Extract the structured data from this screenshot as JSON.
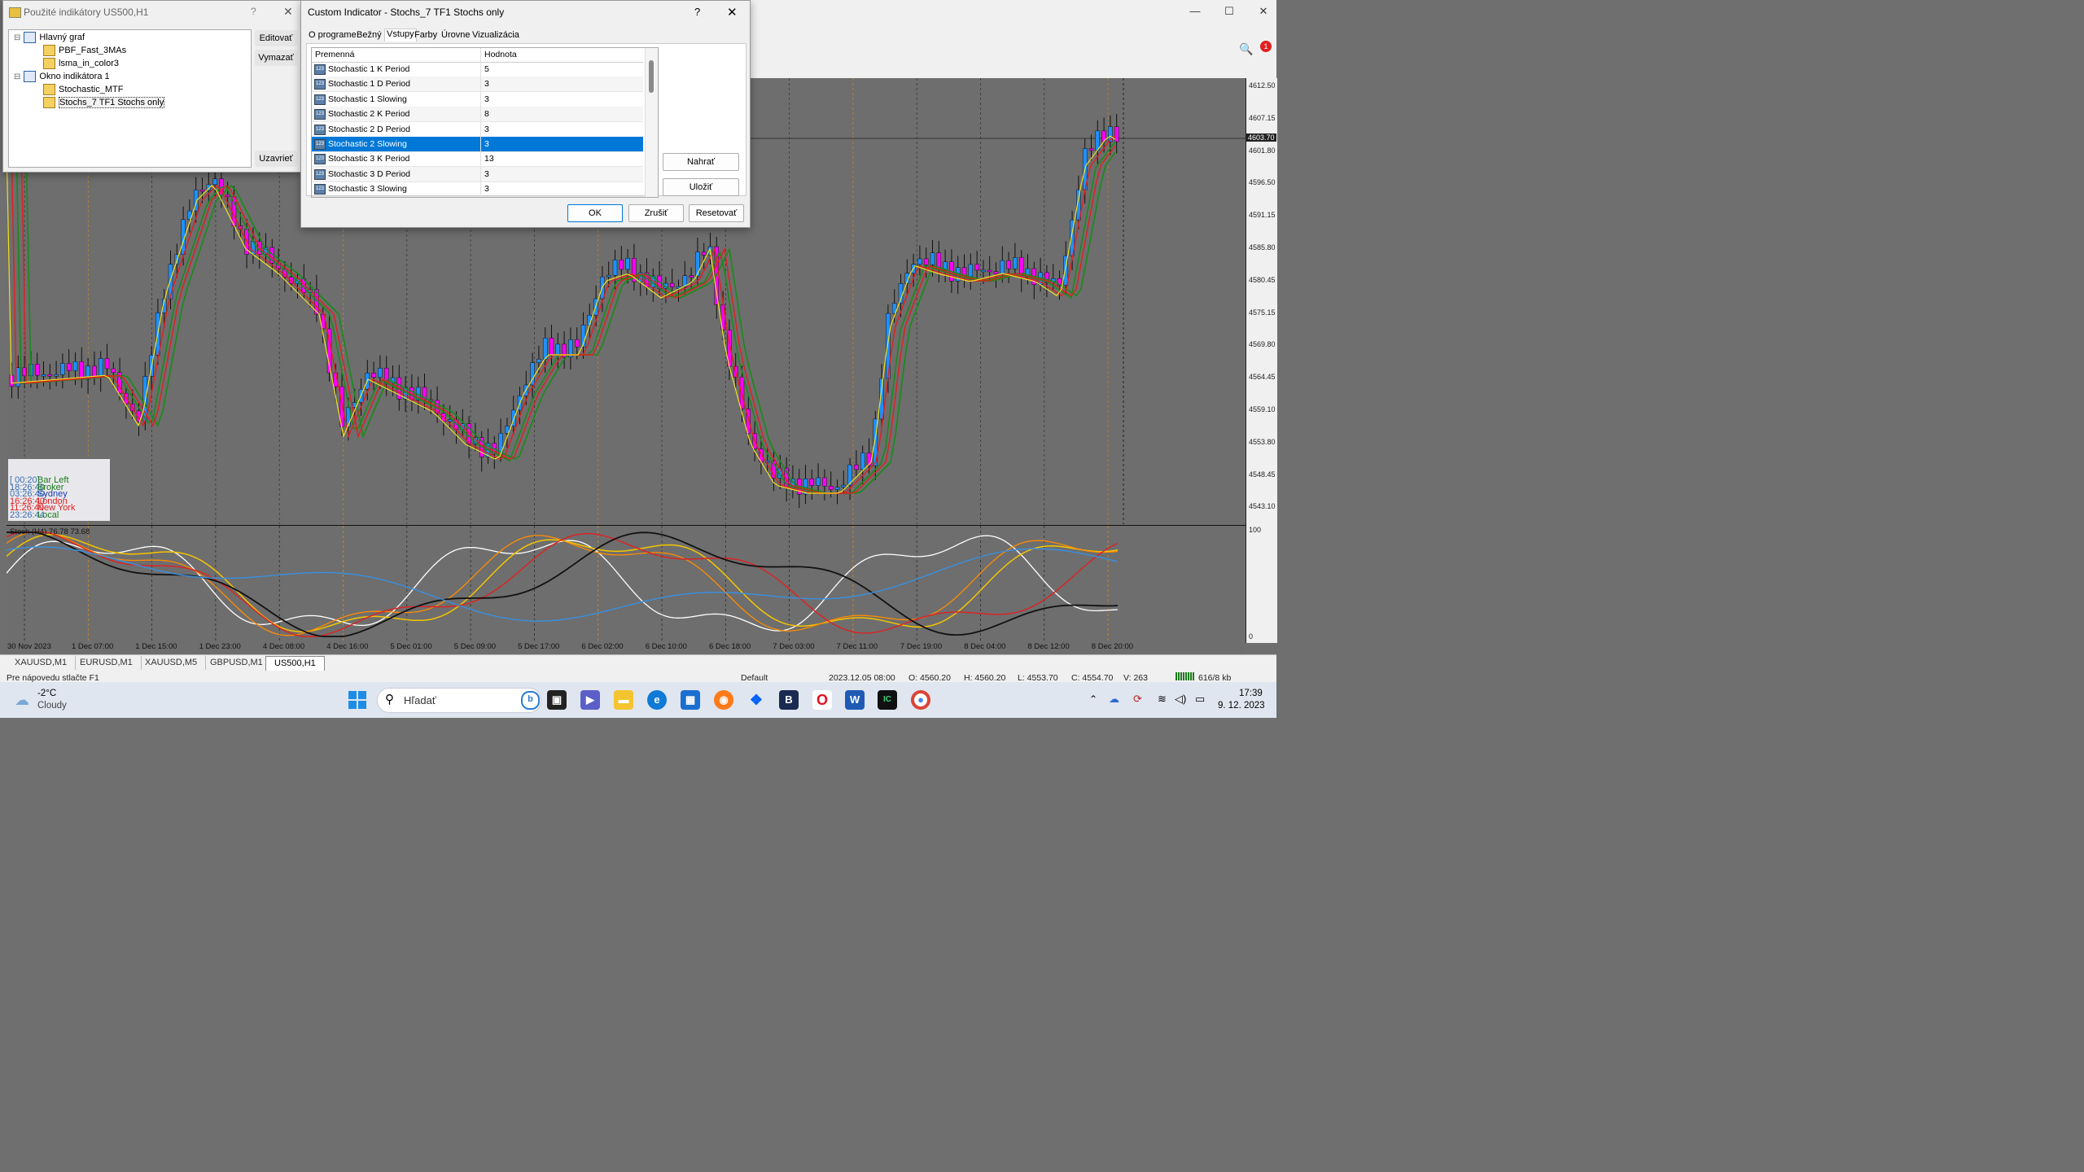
{
  "mt_window": {
    "minimize": "—",
    "maximize": "☐",
    "close": "✕",
    "notification_count": "1"
  },
  "chart": {
    "title_sub": "Stoch (H4) 76.78 73.68",
    "price_ticks": [
      "4612.50",
      "4607.15",
      "4601.80",
      "4596.50",
      "4591.15",
      "4585.80",
      "4580.45",
      "4575.15",
      "4569.80",
      "4564.45",
      "4559.10",
      "4553.80",
      "4548.45",
      "4543.10"
    ],
    "current_price": "4603.70",
    "sub_ticks": [
      "100",
      "0"
    ],
    "time_ticks": [
      "30 Nov 2023",
      "1 Dec 07:00",
      "1 Dec 15:00",
      "1 Dec 23:00",
      "4 Dec 08:00",
      "4 Dec 16:00",
      "5 Dec 01:00",
      "5 Dec 09:00",
      "5 Dec 17:00",
      "6 Dec 02:00",
      "6 Dec 10:00",
      "6 Dec 18:00",
      "7 Dec 03:00",
      "7 Dec 11:00",
      "7 Dec 19:00",
      "8 Dec 04:00",
      "8 Dec 12:00",
      "8 Dec 20:00"
    ],
    "clock": [
      {
        "time": "[ 00:20]",
        "label": "Bar Left",
        "color": "#1a7a1a",
        "tcolor": "#3a6fb0"
      },
      {
        "time": "18:26:40",
        "label": "Broker",
        "color": "#1a7a1a",
        "tcolor": "#3a6fb0"
      },
      {
        "time": "03:26:40",
        "label": "Sydney",
        "color": "#1a3fb0",
        "tcolor": "#3a6fb0"
      },
      {
        "time": "16:26:40",
        "label": "London",
        "color": "#e02020",
        "tcolor": "#e02020"
      },
      {
        "time": "11:26:40",
        "label": "New York",
        "color": "#e02020",
        "tcolor": "#e02020"
      },
      {
        "time": "23:26:44",
        "label": "Local",
        "color": "#1a7a1a",
        "tcolor": "#3a6fb0"
      }
    ]
  },
  "tabs": [
    "XAUUSD,M1",
    "EURUSD,M1",
    "XAUUSD,M5",
    "GBPUSD,M1",
    "US500,H1"
  ],
  "status": {
    "help": "Pre nápovedu stlačte F1",
    "profile": "Default",
    "datetime": "2023.12.05 08:00",
    "open": "O: 4560.20",
    "high": "H: 4560.20",
    "low": "L: 4553.70",
    "close": "C: 4554.70",
    "volume": "V: 263",
    "traffic": "616/8 kb"
  },
  "indicators_dialog": {
    "title": "Použité indikátory US500,H1",
    "help": "?",
    "close": "✕",
    "tree": [
      {
        "label": "Hlavný graf",
        "level": 0,
        "type": "window"
      },
      {
        "label": "PBF_Fast_3MAs",
        "level": 1,
        "type": "indicator"
      },
      {
        "label": "lsma_in_color3",
        "level": 1,
        "type": "indicator"
      },
      {
        "label": "Okno indikátora 1",
        "level": 0,
        "type": "window"
      },
      {
        "label": "Stochastic_MTF",
        "level": 1,
        "type": "indicator"
      },
      {
        "label": "Stochs_7 TF1 Stochs only",
        "level": 1,
        "type": "indicator"
      }
    ],
    "edit_button": "Editovať",
    "delete_button": "Vymazať",
    "close_button": "Uzavrieť"
  },
  "custom_dialog": {
    "title": "Custom Indicator - Stochs_7 TF1 Stochs only",
    "help": "?",
    "close": "✕",
    "tabs": [
      "O programe",
      "Bežný",
      "Vstupy",
      "Farby",
      "Úrovne",
      "Vizualizácia"
    ],
    "active_tab": "Vstupy",
    "col_variable": "Premenná",
    "col_value": "Hodnota",
    "rows": [
      {
        "name": "Stochastic 1 K Period",
        "value": "5"
      },
      {
        "name": "Stochastic 1 D Period",
        "value": "3"
      },
      {
        "name": "Stochastic 1 Slowing",
        "value": "3"
      },
      {
        "name": "Stochastic 2 K Period",
        "value": "8"
      },
      {
        "name": "Stochastic 2 D Period",
        "value": "3"
      },
      {
        "name": "Stochastic 2 Slowing",
        "value": "3"
      },
      {
        "name": "Stochastic 3 K Period",
        "value": "13"
      },
      {
        "name": "Stochastic 3 D Period",
        "value": "3"
      },
      {
        "name": "Stochastic 3 Slowing",
        "value": "3"
      }
    ],
    "row_icon_text": "123",
    "selected_row": 5,
    "load_button": "Nahrať",
    "save_button": "Uložiť",
    "ok_button": "OK",
    "cancel_button": "Zrušiť",
    "reset_button": "Resetovať"
  },
  "taskbar": {
    "temp": "-2°C",
    "weather": "Cloudy",
    "search_placeholder": "Hľadať",
    "time": "17:39",
    "date": "9. 12. 2023"
  }
}
